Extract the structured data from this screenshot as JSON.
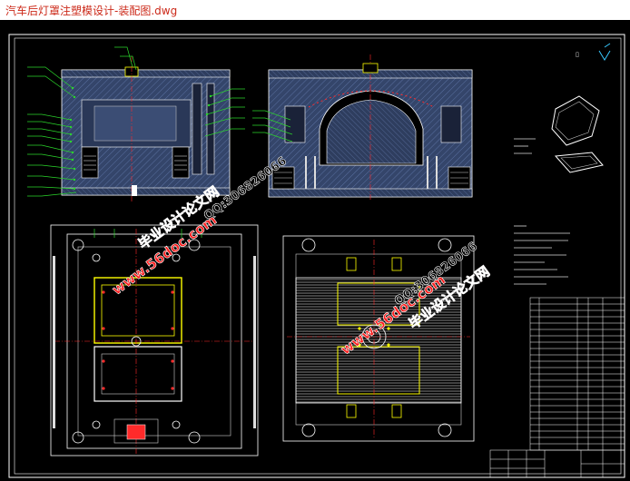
{
  "window": {
    "title": "汽车后灯罩注塑模设计-装配图.dwg"
  },
  "watermarks": {
    "site": "www.56doc.com",
    "brand": "毕业设计论文网",
    "qq": "QQ:306826066"
  },
  "colors": {
    "background": "#000000",
    "outline": "#ffffff",
    "mold_fill": "#3a4a66",
    "hatch": "#4a5f8a",
    "centerline": "#ff2a2a",
    "leader": "#2bd62b",
    "part": "#ffff00",
    "watermark_red": "#ff1e1e"
  }
}
